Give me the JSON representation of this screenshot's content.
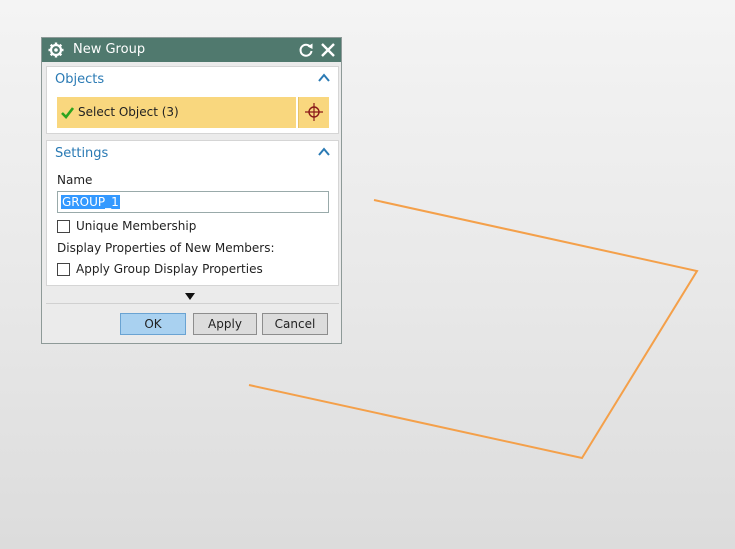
{
  "dialog": {
    "title": "New Group",
    "icons": {
      "settings": "gear-icon",
      "reset": "reset-icon",
      "close": "close-icon"
    }
  },
  "objects": {
    "title": "Objects",
    "select_label": "Select Object (3)"
  },
  "settings": {
    "title": "Settings",
    "name_label": "Name",
    "name_value": "GROUP_1",
    "unique_membership": {
      "label": "Unique Membership",
      "checked": false
    },
    "display_label": "Display Properties of New Members:",
    "apply_group_display": {
      "label": "Apply Group Display Properties",
      "checked": false
    }
  },
  "buttons": {
    "ok": "OK",
    "apply": "Apply",
    "cancel": "Cancel"
  },
  "colors": {
    "titlebar": "#50796e",
    "section_title": "#2a7ab4",
    "selection_highlight": "#f9d77e",
    "ok_button": "#a9d1f0",
    "curve": "#f4a04a"
  }
}
